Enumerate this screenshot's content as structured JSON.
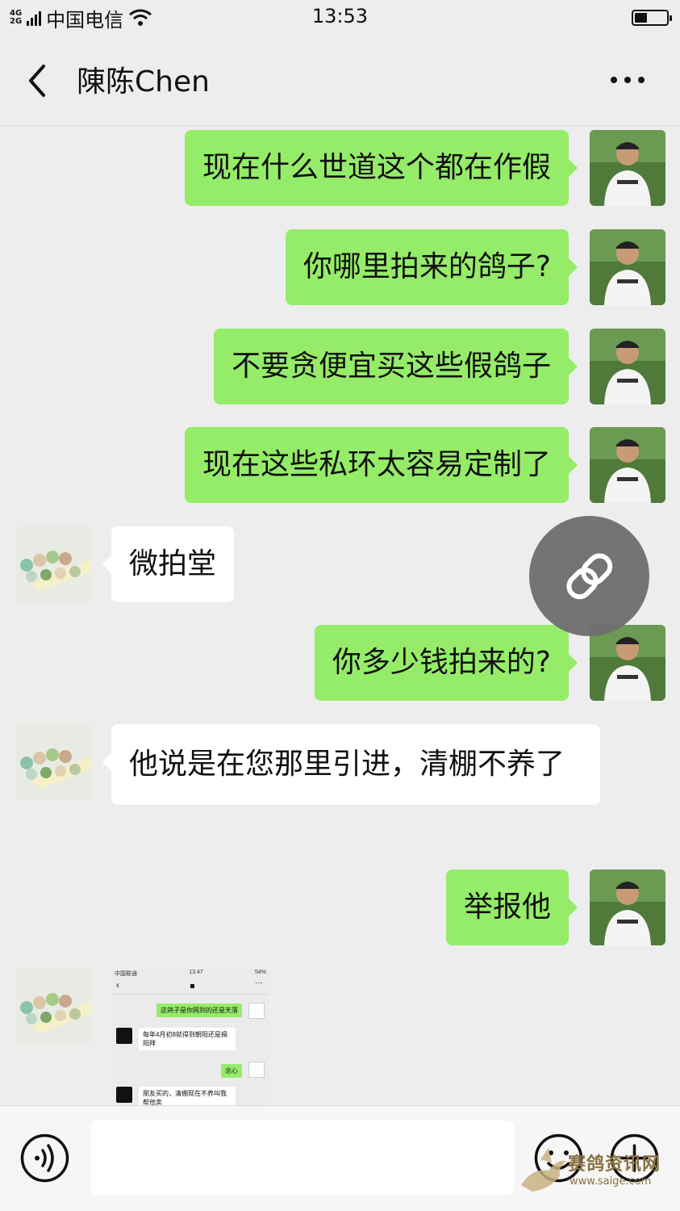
{
  "status_bar": {
    "network_top": "4G",
    "network_bottom": "2G",
    "carrier": "中国电信",
    "time": "13:53",
    "battery_level": 0.4
  },
  "header": {
    "back_icon": "chevron-left-icon",
    "title": "陳陈Chen",
    "more_icon": "more-dots-icon"
  },
  "messages": [
    {
      "from": "me",
      "text": "现在什么世道这个都在作假"
    },
    {
      "from": "me",
      "text": "你哪里拍来的鸽子?"
    },
    {
      "from": "me",
      "text": "不要贪便宜买这些假鸽子"
    },
    {
      "from": "me",
      "text": "现在这些私环太容易定制了"
    },
    {
      "from": "other",
      "text": "微拍堂"
    },
    {
      "from": "me",
      "text": "你多少钱拍来的?"
    },
    {
      "from": "other",
      "text": "他说是在您那里引进，清棚不养了"
    },
    {
      "from": "me",
      "text": "举报他"
    },
    {
      "from": "other",
      "type": "image"
    }
  ],
  "thumbnail": {
    "carrier": "中国联通",
    "time": "13:47",
    "battery": "54%",
    "lines": [
      "这鸽子是你网到的还是天落",
      "每年4月初8就得到朝阳还是揭阳拜",
      "念心",
      "朋友买的，清棚现在不养叫我帮他卖"
    ]
  },
  "floating_button": {
    "icon": "link-icon"
  },
  "input_bar": {
    "voice_icon": "voice-icon",
    "emoji_icon": "emoji-icon",
    "plus_icon": "plus-icon",
    "input_value": ""
  },
  "watermark": {
    "text": "赛鸽资讯网",
    "url": "www.saige.com"
  },
  "colors": {
    "me_bubble": "#95ec69",
    "other_bubble": "#ffffff",
    "background": "#ededed"
  }
}
